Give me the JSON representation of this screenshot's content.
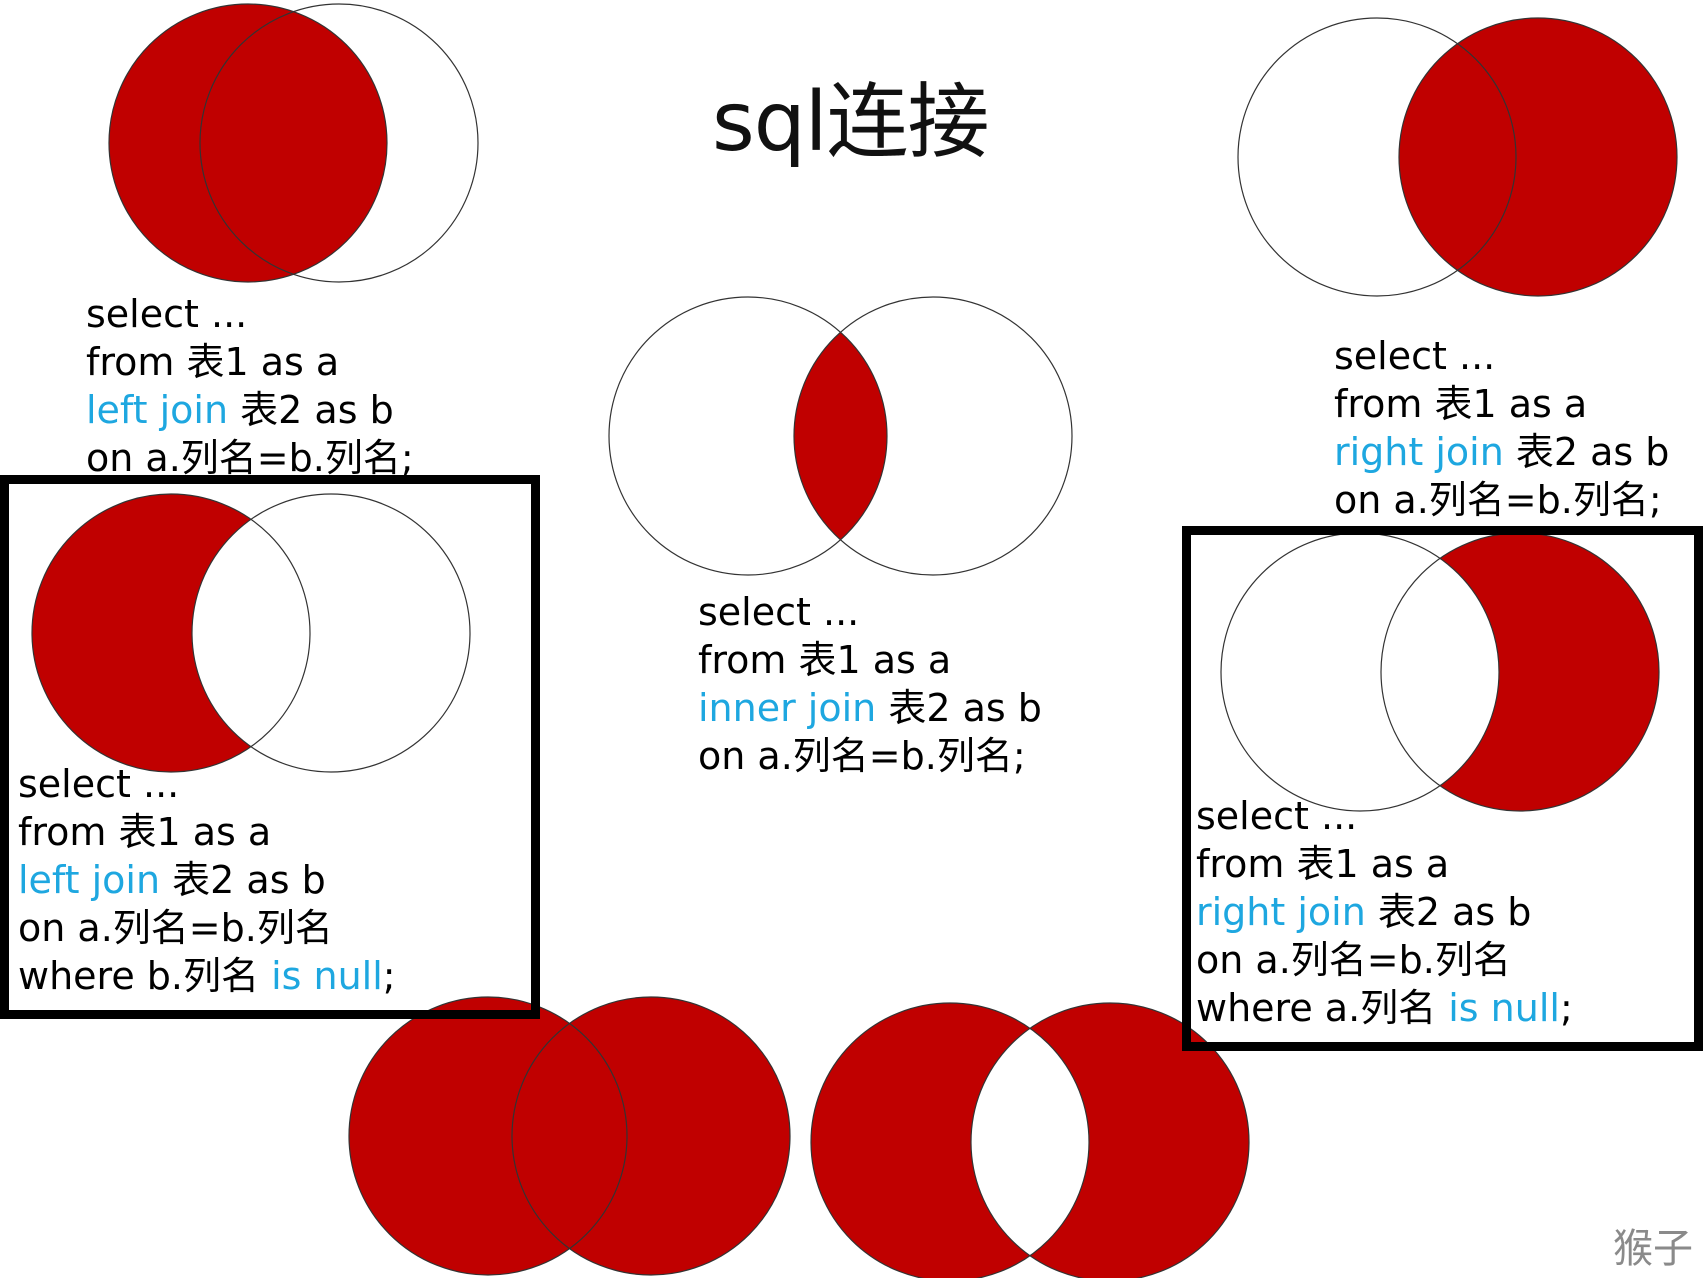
{
  "title": "sql连接",
  "colors": {
    "fill": "#c00000",
    "stroke": "#333333",
    "keyword": "#1ea7e0",
    "frame": "#000000"
  },
  "diagrams": [
    {
      "id": "left-join",
      "code": [
        [
          {
            "t": "select ..."
          }
        ],
        [
          {
            "t": "from 表1 as a"
          }
        ],
        [
          {
            "t": "left join",
            "kw": true
          },
          {
            "t": " 表2 as b"
          }
        ],
        [
          {
            "t": "on a.列名=b.列名;"
          }
        ]
      ]
    },
    {
      "id": "right-join",
      "code": [
        [
          {
            "t": "select ..."
          }
        ],
        [
          {
            "t": "from 表1 as a"
          }
        ],
        [
          {
            "t": "right join",
            "kw": true
          },
          {
            "t": " 表2 as b"
          }
        ],
        [
          {
            "t": "on a.列名=b.列名;"
          }
        ]
      ]
    },
    {
      "id": "inner-join",
      "code": [
        [
          {
            "t": "select ..."
          }
        ],
        [
          {
            "t": "from 表1 as a"
          }
        ],
        [
          {
            "t": "inner join",
            "kw": true
          },
          {
            "t": " 表2 as b"
          }
        ],
        [
          {
            "t": "on a.列名=b.列名;"
          }
        ]
      ]
    },
    {
      "id": "left-join-null",
      "code": [
        [
          {
            "t": "select ..."
          }
        ],
        [
          {
            "t": "from 表1 as a"
          }
        ],
        [
          {
            "t": "left join",
            "kw": true
          },
          {
            "t": " 表2 as b"
          }
        ],
        [
          {
            "t": "on a.列名=b.列名"
          }
        ],
        [
          {
            "t": "where b.列名 "
          },
          {
            "t": "is null",
            "kw": true
          },
          {
            "t": ";"
          }
        ]
      ]
    },
    {
      "id": "right-join-null",
      "code": [
        [
          {
            "t": "select ..."
          }
        ],
        [
          {
            "t": "from 表1 as a"
          }
        ],
        [
          {
            "t": "right join",
            "kw": true
          },
          {
            "t": " 表2 as b"
          }
        ],
        [
          {
            "t": "on a.列名=b.列名"
          }
        ],
        [
          {
            "t": "where a.列名 "
          },
          {
            "t": "is null",
            "kw": true
          },
          {
            "t": ";"
          }
        ]
      ]
    },
    {
      "id": "full-join",
      "code": []
    },
    {
      "id": "full-join-exclusive",
      "code": []
    }
  ],
  "watermark": "猴子"
}
